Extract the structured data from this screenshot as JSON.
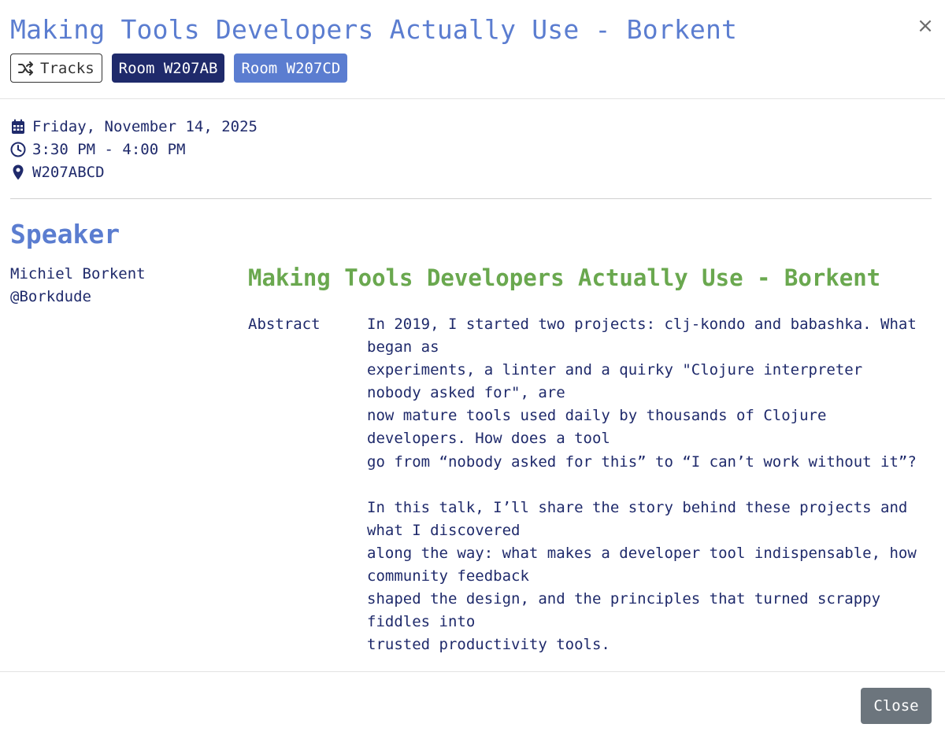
{
  "modal": {
    "title": "Making Tools Developers Actually Use - Borkent",
    "close_icon": "×"
  },
  "tags": {
    "tracks_icon": "shuffle-icon",
    "tracks_label": "Tracks",
    "room1": "Room W207AB",
    "room2": "Room W207CD"
  },
  "meta": {
    "date": "Friday, November 14, 2025",
    "time": "3:30 PM - 4:00 PM",
    "location": "W207ABCD"
  },
  "speaker": {
    "heading": "Speaker",
    "name": "Michiel Borkent",
    "handle": "@Borkdude"
  },
  "talk": {
    "title": "Making Tools Developers Actually Use - Borkent",
    "abstract_label": "Abstract",
    "abstract_lines": [
      "In 2019, I started two projects: clj-kondo and babashka. What",
      "began as",
      "experiments, a linter and a quirky \"Clojure interpreter",
      "nobody asked for\", are",
      "now mature tools used daily by thousands of Clojure",
      "developers. How does a tool",
      "go from “nobody asked for this” to “I can’t work without it”?",
      "",
      "In this talk, I’ll share the story behind these projects and",
      "what I discovered",
      "along the way: what makes a developer tool indispensable, how",
      "community feedback",
      "shaped the design, and the principles that turned scrappy",
      "fiddles into",
      "trusted productivity tools."
    ]
  },
  "footer": {
    "close_label": "Close"
  },
  "colors": {
    "title": "#5b7dd0",
    "text": "#1f2a6b",
    "talk_title": "#6aa84f",
    "room_dark": "#1f2a6b",
    "room_light": "#5b7dd0",
    "close_button": "#6c757d"
  }
}
